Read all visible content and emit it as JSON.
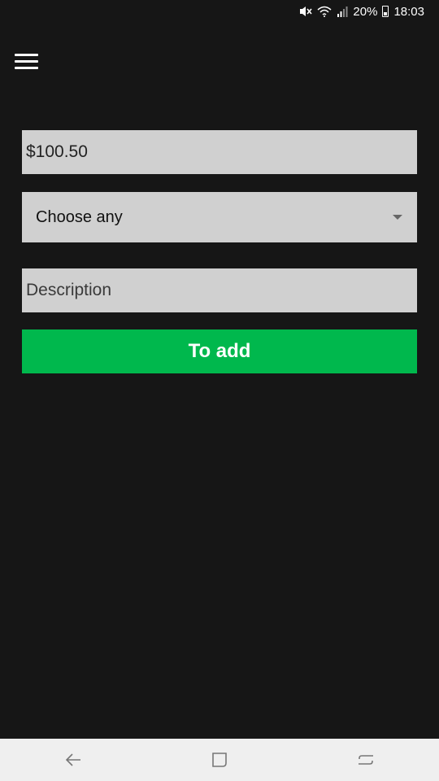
{
  "status_bar": {
    "battery": "20%",
    "time": "18:03",
    "icons": [
      "mute-icon",
      "wifi-icon",
      "signal-icon",
      "battery-icon"
    ]
  },
  "app_bar": {
    "menu_icon": "hamburger-menu-icon"
  },
  "form": {
    "amount": {
      "value": "$100.50"
    },
    "category": {
      "selected": "Choose any"
    },
    "description": {
      "placeholder": "Description",
      "value": ""
    },
    "submit_label": "To add"
  },
  "nav_bar": {
    "icons": [
      "back-icon",
      "home-icon",
      "recents-icon"
    ]
  },
  "colors": {
    "background": "#161616",
    "field": "#d0d0d0",
    "accent": "#00b84d",
    "nav_bar": "#efefef"
  }
}
